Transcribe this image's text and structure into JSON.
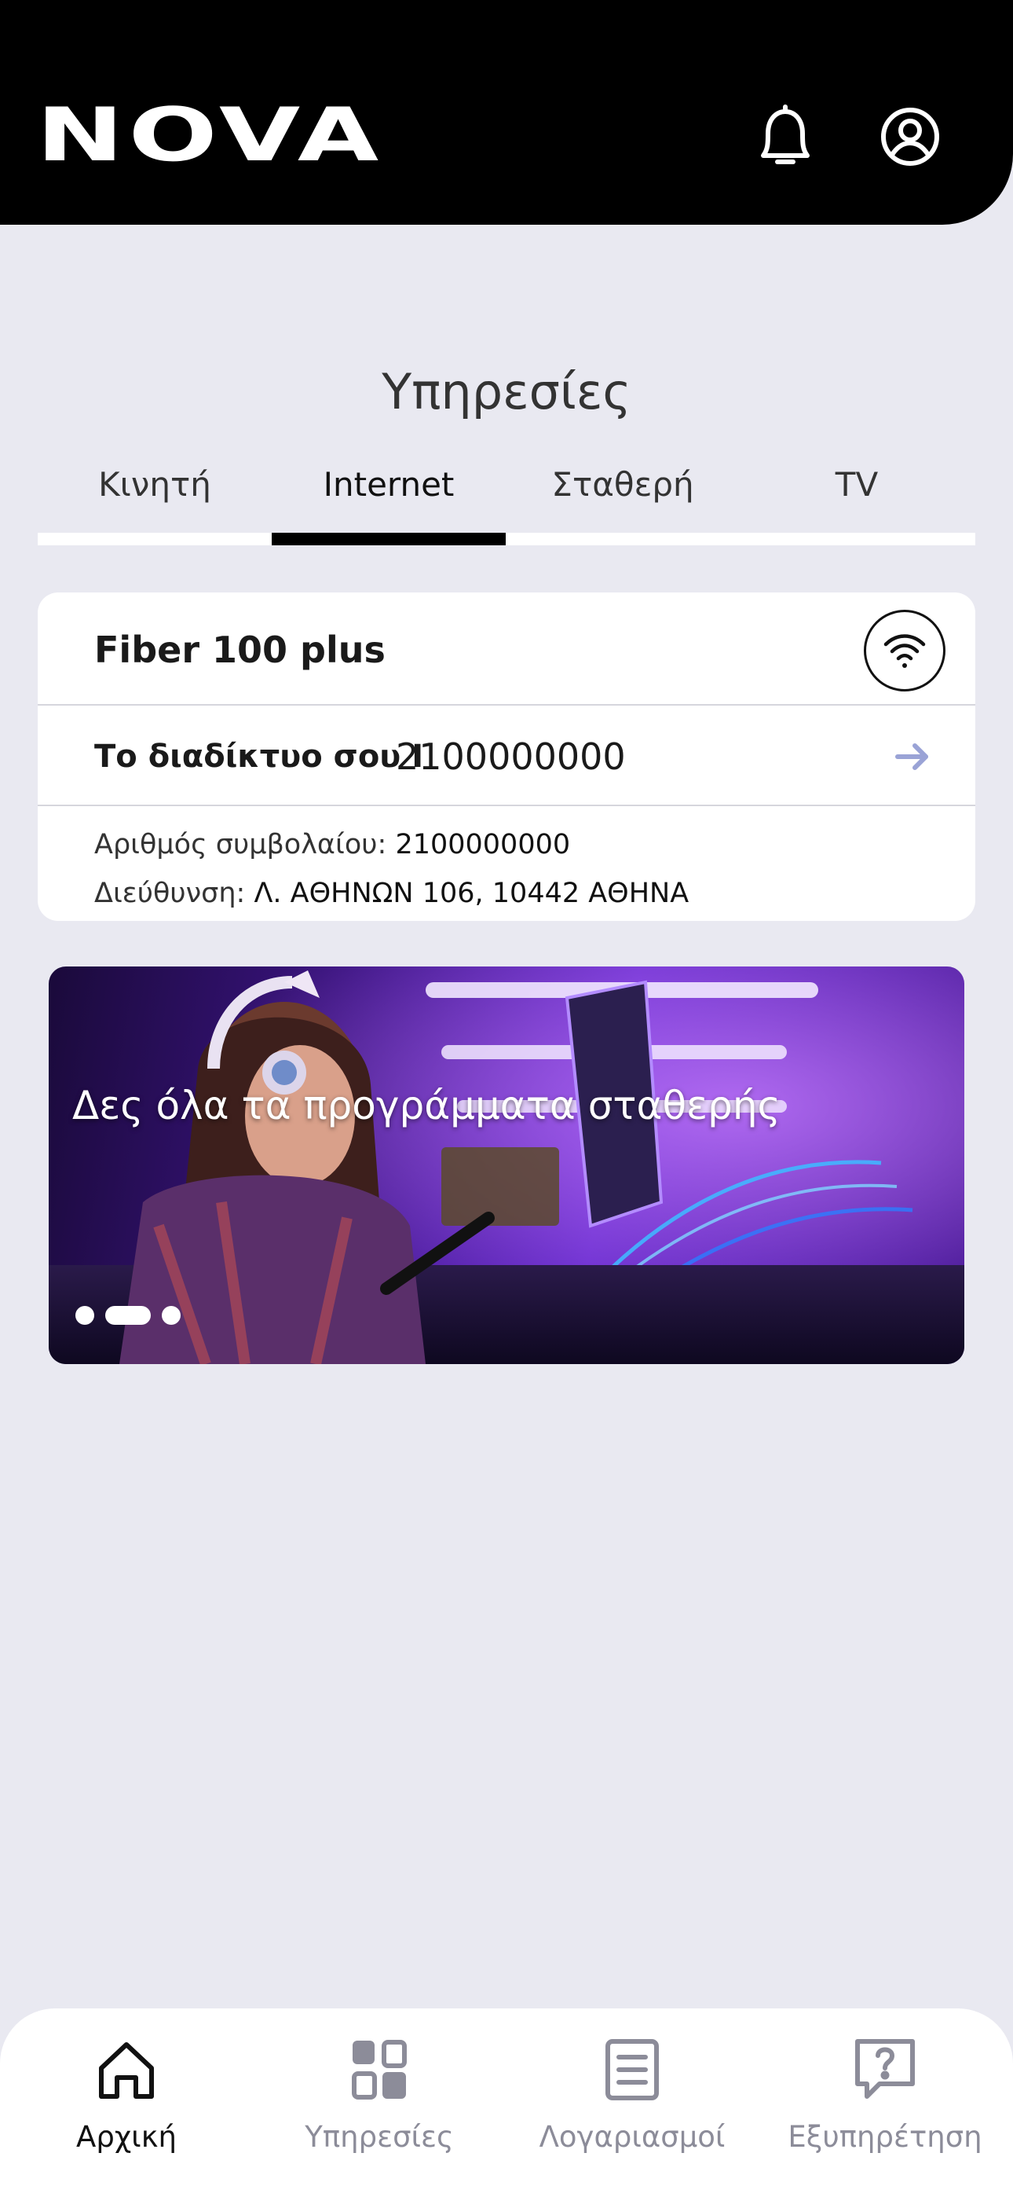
{
  "header": {
    "logo": "NOVA",
    "icons": [
      "bell-icon",
      "user-icon"
    ]
  },
  "page_title": "Υπηρεσίες",
  "tabs": [
    {
      "label": "Κινητή",
      "active": false
    },
    {
      "label": "Internet",
      "active": true
    },
    {
      "label": "Σταθερή",
      "active": false
    },
    {
      "label": "TV",
      "active": false
    }
  ],
  "service_card": {
    "plan_name": "Fiber 100 plus",
    "plan_icon": "wifi-icon",
    "internet_label": "Το διαδίκτυο σου I",
    "internet_number": "2100000000",
    "arrow_icon": "arrow-right-icon",
    "contract_label": "Αριθμός συμβολαίου:",
    "contract_value": "2100000000",
    "address_label": "Διεύθυνση:",
    "address_value": "Λ. ΑΘΗΝΩΝ 106, 10442 ΑΘΗΝΑ"
  },
  "banner": {
    "text": "Δες όλα τα προγράμματα σταθερής",
    "slides": 3,
    "active_slide": 2
  },
  "bottom_nav": [
    {
      "label": "Αρχική",
      "icon": "home-icon",
      "active": true
    },
    {
      "label": "Υπηρεσίες",
      "icon": "grid-icon",
      "active": false
    },
    {
      "label": "Λογαριασμοί",
      "icon": "bill-icon",
      "active": false
    },
    {
      "label": "Εξυπηρέτηση",
      "icon": "help-chat-icon",
      "active": false
    }
  ],
  "colors": {
    "background": "#e9e9f1",
    "header": "#000000",
    "accent_arrow": "#9aa3d6",
    "nav_inactive": "#8c8c99"
  }
}
